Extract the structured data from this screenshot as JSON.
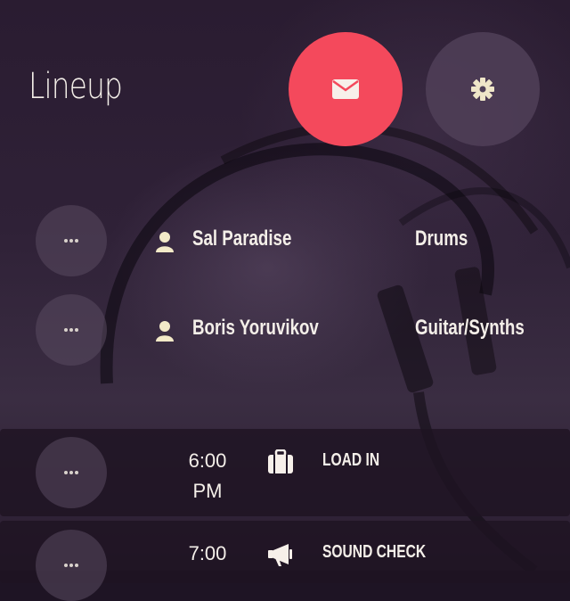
{
  "header": {
    "title": "Lineup",
    "mail_icon": "envelope-icon",
    "settings_icon": "gear-icon",
    "accent_color": "#f4495c"
  },
  "lineup": [
    {
      "name": "Sal Paradise",
      "role": "Drums"
    },
    {
      "name": "Boris Yoruvikov",
      "role": "Guitar/Synths"
    }
  ],
  "schedule": [
    {
      "time": "6:00 PM",
      "time_line1": "6:00",
      "time_line2": "PM",
      "event": "LOAD IN",
      "icon": "suitcase-icon"
    },
    {
      "time": "7:00",
      "time_line1": "7:00",
      "time_line2": "",
      "event": "SOUND CHECK",
      "icon": "megaphone-icon"
    }
  ]
}
